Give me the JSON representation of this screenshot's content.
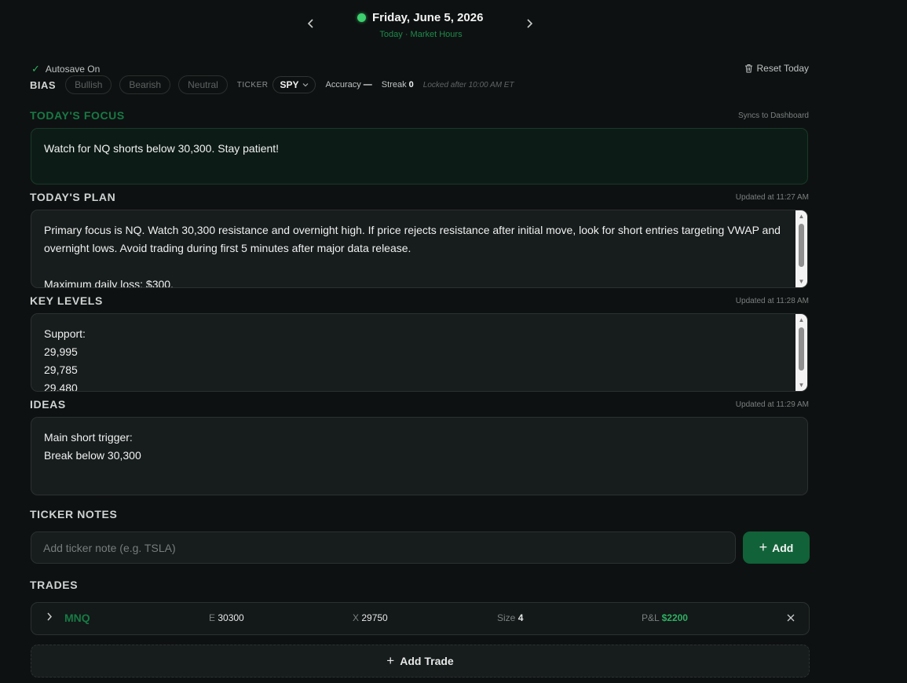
{
  "header": {
    "date": "Friday, June 5, 2026",
    "subtitle": "Today · Market Hours",
    "prev_icon": "chevron-left-icon",
    "next_icon": "chevron-right-icon",
    "status_color": "#3ecf6f"
  },
  "toolbar": {
    "autosave": "Autosave On",
    "reset": "Reset Today",
    "bias_label": "BIAS",
    "bias_options": [
      "Bullish",
      "Bearish",
      "Neutral"
    ],
    "ticker_label": "TICKER",
    "ticker_value": "SPY",
    "accuracy_label": "Accuracy",
    "accuracy_value": "—",
    "streak_label": "Streak",
    "streak_value": "0",
    "locked_note": "Locked after 10:00 AM ET"
  },
  "focus": {
    "title": "TODAY'S FOCUS",
    "meta": "Syncs to Dashboard",
    "text": "Watch for NQ shorts below 30,300. Stay patient!"
  },
  "plan": {
    "title": "TODAY'S PLAN",
    "meta": "Updated at 11:27 AM",
    "text": "Primary focus is NQ. Watch 30,300 resistance and overnight high. If price rejects resistance after initial move, look for short entries targeting VWAP and overnight lows. Avoid trading during first 5 minutes after major data release.\n\nMaximum daily loss: $300."
  },
  "levels": {
    "title": "KEY LEVELS",
    "meta": "Updated at 11:28 AM",
    "text": "Support:\n29,995\n29,785\n29,480"
  },
  "ideas": {
    "title": "IDEAS",
    "meta": "Updated at 11:29 AM",
    "text": "Main short trigger:\nBreak below 30,300"
  },
  "ticker_notes": {
    "title": "TICKER NOTES",
    "placeholder": "Add ticker note (e.g. TSLA)",
    "add_label": "Add"
  },
  "trades": {
    "title": "TRADES",
    "rows": [
      {
        "symbol": "MNQ",
        "entry_label": "E",
        "entry": "30300",
        "exit_label": "X",
        "exit": "29750",
        "size_label": "Size",
        "size": "4",
        "pnl_label": "P&L",
        "pnl": "$2200"
      }
    ],
    "add_label": "Add Trade"
  }
}
